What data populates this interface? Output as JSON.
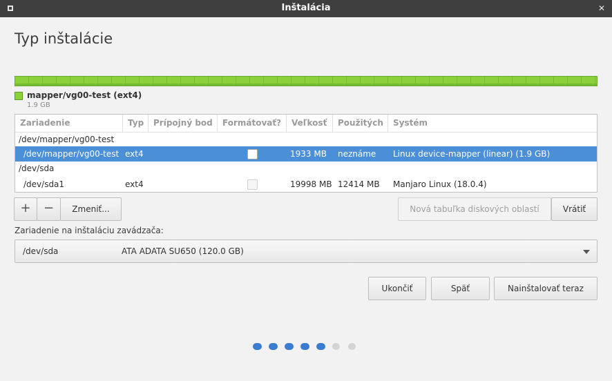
{
  "window": {
    "title": "Inštalácia"
  },
  "page": {
    "heading": "Typ inštalácie"
  },
  "partition_bar": {
    "color": "#8bd13c",
    "legend": {
      "label": "mapper/vg00-test (ext4)",
      "size": "1.9 GB"
    }
  },
  "table": {
    "columns": [
      "Zariadenie",
      "Typ",
      "Prípojný bod",
      "Formátovať?",
      "Veľkosť",
      "Použitých",
      "Systém"
    ],
    "rows": [
      {
        "device": "/dev/mapper/vg00-test",
        "type": "",
        "mount": "",
        "format": null,
        "size": "",
        "used": "",
        "system": "",
        "selected": false,
        "group": true
      },
      {
        "device": "/dev/mapper/vg00-test",
        "type": "ext4",
        "mount": "",
        "format": false,
        "size": "1933 MB",
        "used": "neznáme",
        "system": "Linux device-mapper (linear) (1.9 GB)",
        "selected": true,
        "group": false
      },
      {
        "device": "/dev/sda",
        "type": "",
        "mount": "",
        "format": null,
        "size": "",
        "used": "",
        "system": "",
        "selected": false,
        "group": true
      },
      {
        "device": "/dev/sda1",
        "type": "ext4",
        "mount": "",
        "format": false,
        "size": "19998 MB",
        "used": "12414 MB",
        "system": "Manjaro Linux (18.0.4)",
        "selected": false,
        "group": false
      }
    ]
  },
  "toolbar": {
    "add_label": "+",
    "remove_label": "−",
    "change_label": "Zmeniť...",
    "new_table_label": "Nová tabuľka diskových oblastí",
    "revert_label": "Vrátiť"
  },
  "bootloader": {
    "label": "Zariadenie na inštaláciu zavádzača:",
    "device": "/dev/sda",
    "model": "ATA ADATA SU650 (120.0 GB)"
  },
  "actions": {
    "quit_label": "Ukončiť",
    "back_label": "Späť",
    "install_label": "Nainštalovať teraz"
  },
  "progress": {
    "total_steps": 7,
    "completed_steps": 5,
    "active_color": "#3a7cd0"
  }
}
